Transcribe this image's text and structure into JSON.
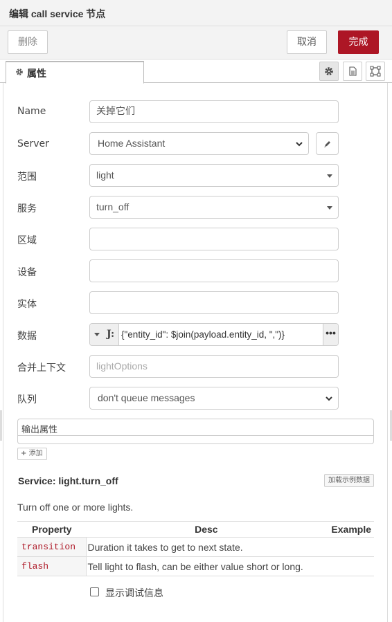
{
  "header": {
    "title": "编辑 call service 节点"
  },
  "toolbar": {
    "delete_label": "删除",
    "cancel_label": "取消",
    "done_label": "完成"
  },
  "tabs": {
    "properties_label": "属性"
  },
  "form": {
    "name": {
      "label": "Name",
      "value": "关掉它们"
    },
    "server": {
      "label": "Server",
      "value": "Home Assistant"
    },
    "domain": {
      "label": "范围",
      "value": "light"
    },
    "service": {
      "label": "服务",
      "value": "turn_off"
    },
    "area": {
      "label": "区域",
      "value": ""
    },
    "device": {
      "label": "设备",
      "value": ""
    },
    "entity": {
      "label": "实体",
      "value": ""
    },
    "data": {
      "label": "数据",
      "type_icon": "J:",
      "value": "{\"entity_id\": $join(payload.entity_id, \",\")}",
      "more": "•••"
    },
    "merge_context": {
      "label": "合并上下文",
      "placeholder": "lightOptions"
    },
    "queue": {
      "label": "队列",
      "value": "don't queue messages"
    }
  },
  "output": {
    "label": "输出属性",
    "add_label": "添加"
  },
  "service_info": {
    "title": "Service: light.turn_off",
    "load_example_label": "加载示例数据",
    "description": "Turn off one or more lights.",
    "headers": [
      "Property",
      "Desc",
      "Example"
    ],
    "rows": [
      {
        "property": "transition",
        "desc": "Duration it takes to get to next state.",
        "example": ""
      },
      {
        "property": "flash",
        "desc": "Tell light to flash, can be either value short or long.",
        "example": ""
      }
    ]
  },
  "debug": {
    "label": "显示调试信息",
    "checked": false
  },
  "colors": {
    "primary": "#ad1625",
    "property": "#ad1625"
  }
}
